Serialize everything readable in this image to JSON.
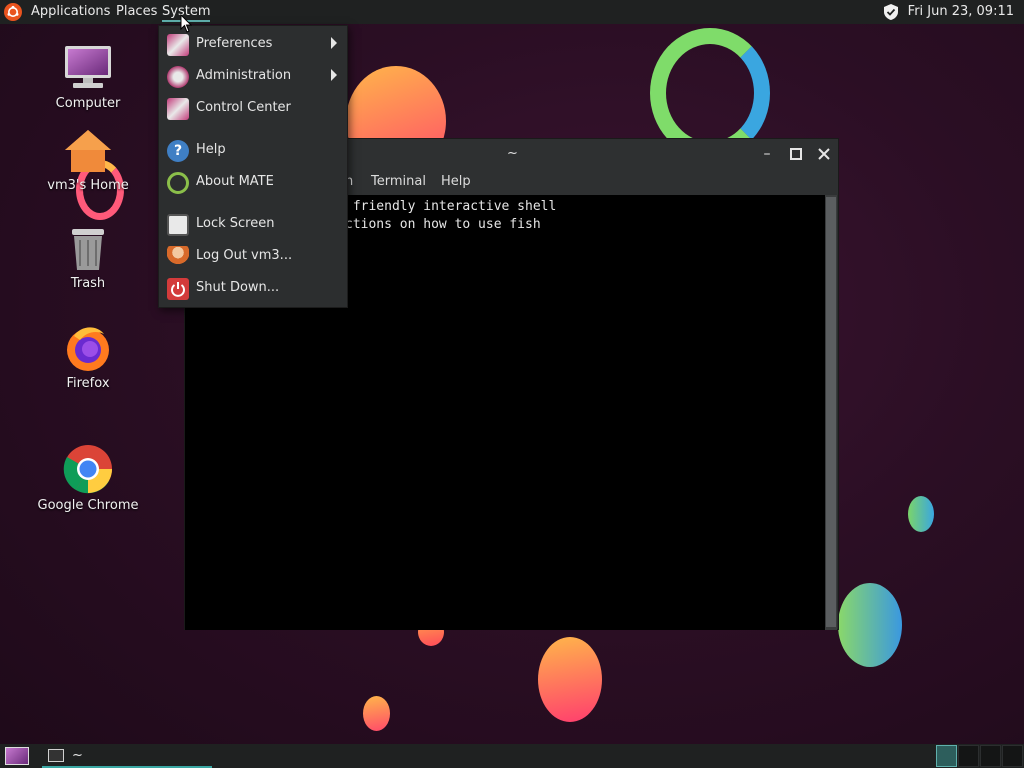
{
  "top_panel": {
    "menus": [
      "Applications",
      "Places",
      "System"
    ],
    "clock": "Fri Jun 23, 09:11"
  },
  "desktop": {
    "icons": [
      {
        "label": "Computer"
      },
      {
        "label": "vm3's Home"
      },
      {
        "label": "Trash"
      },
      {
        "label": "Firefox"
      },
      {
        "label": "Google Chrome"
      }
    ]
  },
  "system_menu": {
    "items": [
      {
        "label": "Preferences",
        "icon": "preferences-icon",
        "submenu": true
      },
      {
        "label": "Administration",
        "icon": "administration-icon",
        "submenu": true
      },
      {
        "label": "Control Center",
        "icon": "control-center-icon",
        "submenu": false
      },
      {
        "label": "Help",
        "icon": "help-icon",
        "submenu": false
      },
      {
        "label": "About MATE",
        "icon": "mate-logo-icon",
        "submenu": false
      },
      {
        "label": "Lock Screen",
        "icon": "lock-screen-icon",
        "submenu": false
      },
      {
        "label": "Log Out vm3...",
        "icon": "log-out-icon",
        "submenu": false
      },
      {
        "label": "Shut Down...",
        "icon": "power-icon",
        "submenu": false
      }
    ]
  },
  "terminal": {
    "title": "~",
    "menu_visible": [
      "n",
      "Terminal",
      "Help"
    ],
    "lines": [
      " friendly interactive shell",
      "ctions on how to use fish"
    ]
  },
  "taskbar": {
    "task_label": "~",
    "workspace_active": 1
  },
  "colors": {
    "panel": "#1f2121",
    "accent": "#5fb0ad",
    "menu_bg": "#2c2e2f"
  }
}
